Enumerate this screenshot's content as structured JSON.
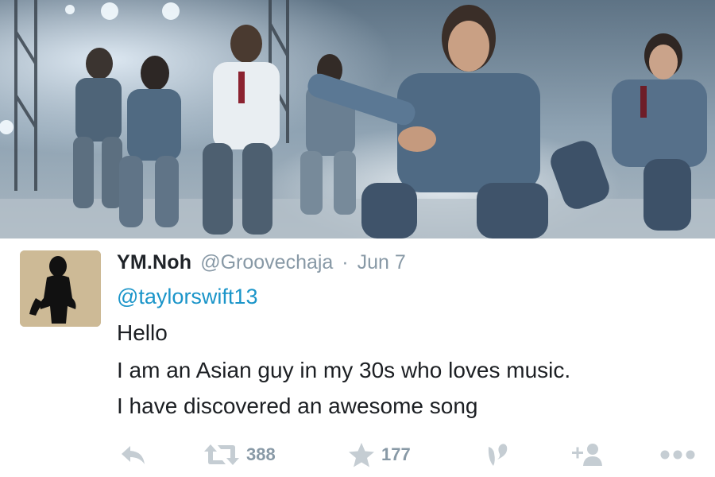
{
  "tweet": {
    "display_name": "YM.Noh",
    "handle": "@Groovechaja",
    "separator": "·",
    "date": "Jun 7",
    "mention": "@taylorswift13",
    "lines": [
      "Hello",
      "I am an Asian guy in my 30s who loves music.",
      "I have discovered an awesome song"
    ]
  },
  "actions": {
    "reply_icon": "reply-arrow-icon",
    "retweet_icon": "retweet-icon",
    "retweet_count": "388",
    "favorite_icon": "star-icon",
    "favorite_count": "177",
    "vine_icon": "vine-icon",
    "follow_icon": "follow-user-plus-icon",
    "more_icon": "ellipsis-icon"
  },
  "media": {
    "description_icon": "group-dance-photo"
  },
  "colors": {
    "name": "#1f2328",
    "meta": "#8899a6",
    "link": "#1b95c9",
    "icon": "#c5cdd3",
    "text": "#1c1f23"
  }
}
